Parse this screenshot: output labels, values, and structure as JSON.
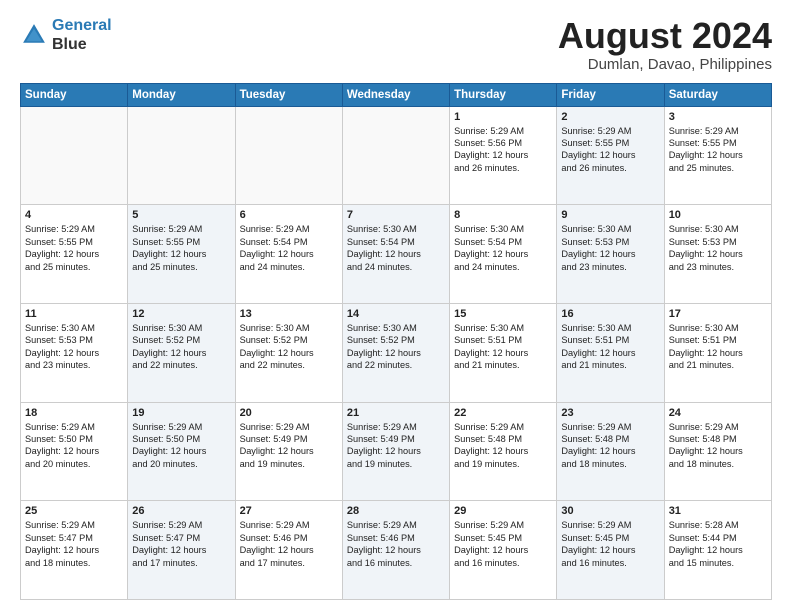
{
  "header": {
    "logo_line1": "General",
    "logo_line2": "Blue",
    "month_year": "August 2024",
    "location": "Dumlan, Davao, Philippines"
  },
  "days_of_week": [
    "Sunday",
    "Monday",
    "Tuesday",
    "Wednesday",
    "Thursday",
    "Friday",
    "Saturday"
  ],
  "weeks": [
    [
      {
        "day": "",
        "info": "",
        "shaded": false
      },
      {
        "day": "",
        "info": "",
        "shaded": false
      },
      {
        "day": "",
        "info": "",
        "shaded": false
      },
      {
        "day": "",
        "info": "",
        "shaded": false
      },
      {
        "day": "1",
        "info": "Sunrise: 5:29 AM\nSunset: 5:56 PM\nDaylight: 12 hours\nand 26 minutes.",
        "shaded": false
      },
      {
        "day": "2",
        "info": "Sunrise: 5:29 AM\nSunset: 5:55 PM\nDaylight: 12 hours\nand 26 minutes.",
        "shaded": true
      },
      {
        "day": "3",
        "info": "Sunrise: 5:29 AM\nSunset: 5:55 PM\nDaylight: 12 hours\nand 25 minutes.",
        "shaded": false
      }
    ],
    [
      {
        "day": "4",
        "info": "Sunrise: 5:29 AM\nSunset: 5:55 PM\nDaylight: 12 hours\nand 25 minutes.",
        "shaded": false
      },
      {
        "day": "5",
        "info": "Sunrise: 5:29 AM\nSunset: 5:55 PM\nDaylight: 12 hours\nand 25 minutes.",
        "shaded": true
      },
      {
        "day": "6",
        "info": "Sunrise: 5:29 AM\nSunset: 5:54 PM\nDaylight: 12 hours\nand 24 minutes.",
        "shaded": false
      },
      {
        "day": "7",
        "info": "Sunrise: 5:30 AM\nSunset: 5:54 PM\nDaylight: 12 hours\nand 24 minutes.",
        "shaded": true
      },
      {
        "day": "8",
        "info": "Sunrise: 5:30 AM\nSunset: 5:54 PM\nDaylight: 12 hours\nand 24 minutes.",
        "shaded": false
      },
      {
        "day": "9",
        "info": "Sunrise: 5:30 AM\nSunset: 5:53 PM\nDaylight: 12 hours\nand 23 minutes.",
        "shaded": true
      },
      {
        "day": "10",
        "info": "Sunrise: 5:30 AM\nSunset: 5:53 PM\nDaylight: 12 hours\nand 23 minutes.",
        "shaded": false
      }
    ],
    [
      {
        "day": "11",
        "info": "Sunrise: 5:30 AM\nSunset: 5:53 PM\nDaylight: 12 hours\nand 23 minutes.",
        "shaded": false
      },
      {
        "day": "12",
        "info": "Sunrise: 5:30 AM\nSunset: 5:52 PM\nDaylight: 12 hours\nand 22 minutes.",
        "shaded": true
      },
      {
        "day": "13",
        "info": "Sunrise: 5:30 AM\nSunset: 5:52 PM\nDaylight: 12 hours\nand 22 minutes.",
        "shaded": false
      },
      {
        "day": "14",
        "info": "Sunrise: 5:30 AM\nSunset: 5:52 PM\nDaylight: 12 hours\nand 22 minutes.",
        "shaded": true
      },
      {
        "day": "15",
        "info": "Sunrise: 5:30 AM\nSunset: 5:51 PM\nDaylight: 12 hours\nand 21 minutes.",
        "shaded": false
      },
      {
        "day": "16",
        "info": "Sunrise: 5:30 AM\nSunset: 5:51 PM\nDaylight: 12 hours\nand 21 minutes.",
        "shaded": true
      },
      {
        "day": "17",
        "info": "Sunrise: 5:30 AM\nSunset: 5:51 PM\nDaylight: 12 hours\nand 21 minutes.",
        "shaded": false
      }
    ],
    [
      {
        "day": "18",
        "info": "Sunrise: 5:29 AM\nSunset: 5:50 PM\nDaylight: 12 hours\nand 20 minutes.",
        "shaded": false
      },
      {
        "day": "19",
        "info": "Sunrise: 5:29 AM\nSunset: 5:50 PM\nDaylight: 12 hours\nand 20 minutes.",
        "shaded": true
      },
      {
        "day": "20",
        "info": "Sunrise: 5:29 AM\nSunset: 5:49 PM\nDaylight: 12 hours\nand 19 minutes.",
        "shaded": false
      },
      {
        "day": "21",
        "info": "Sunrise: 5:29 AM\nSunset: 5:49 PM\nDaylight: 12 hours\nand 19 minutes.",
        "shaded": true
      },
      {
        "day": "22",
        "info": "Sunrise: 5:29 AM\nSunset: 5:48 PM\nDaylight: 12 hours\nand 19 minutes.",
        "shaded": false
      },
      {
        "day": "23",
        "info": "Sunrise: 5:29 AM\nSunset: 5:48 PM\nDaylight: 12 hours\nand 18 minutes.",
        "shaded": true
      },
      {
        "day": "24",
        "info": "Sunrise: 5:29 AM\nSunset: 5:48 PM\nDaylight: 12 hours\nand 18 minutes.",
        "shaded": false
      }
    ],
    [
      {
        "day": "25",
        "info": "Sunrise: 5:29 AM\nSunset: 5:47 PM\nDaylight: 12 hours\nand 18 minutes.",
        "shaded": false
      },
      {
        "day": "26",
        "info": "Sunrise: 5:29 AM\nSunset: 5:47 PM\nDaylight: 12 hours\nand 17 minutes.",
        "shaded": true
      },
      {
        "day": "27",
        "info": "Sunrise: 5:29 AM\nSunset: 5:46 PM\nDaylight: 12 hours\nand 17 minutes.",
        "shaded": false
      },
      {
        "day": "28",
        "info": "Sunrise: 5:29 AM\nSunset: 5:46 PM\nDaylight: 12 hours\nand 16 minutes.",
        "shaded": true
      },
      {
        "day": "29",
        "info": "Sunrise: 5:29 AM\nSunset: 5:45 PM\nDaylight: 12 hours\nand 16 minutes.",
        "shaded": false
      },
      {
        "day": "30",
        "info": "Sunrise: 5:29 AM\nSunset: 5:45 PM\nDaylight: 12 hours\nand 16 minutes.",
        "shaded": true
      },
      {
        "day": "31",
        "info": "Sunrise: 5:28 AM\nSunset: 5:44 PM\nDaylight: 12 hours\nand 15 minutes.",
        "shaded": false
      }
    ]
  ]
}
